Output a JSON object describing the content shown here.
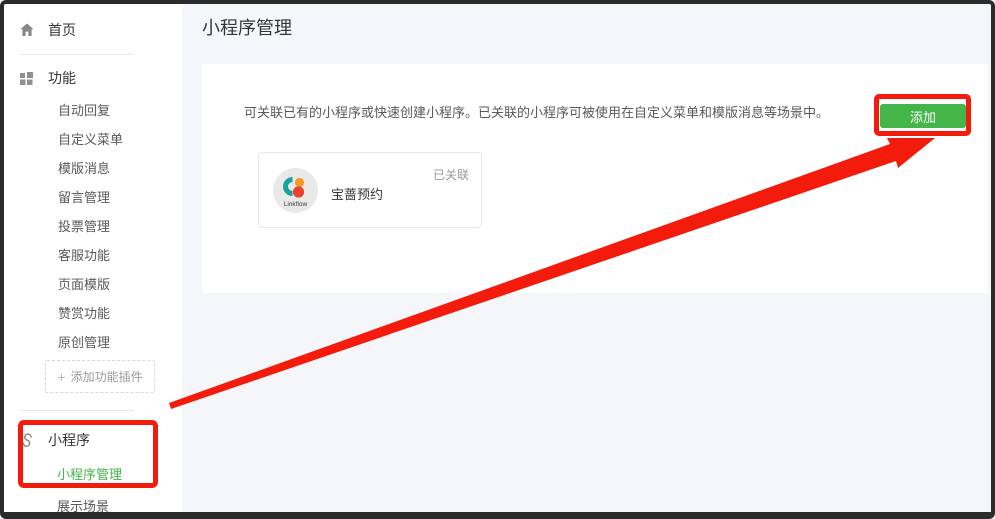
{
  "header": {
    "title": "小程序管理"
  },
  "sidebar": {
    "home": {
      "label": "首页"
    },
    "func": {
      "label": "功能",
      "items": [
        "自动回复",
        "自定义菜单",
        "模版消息",
        "留言管理",
        "投票管理",
        "客服功能",
        "页面模版",
        "赞赏功能",
        "原创管理"
      ]
    },
    "add_plugin": {
      "icon": "+",
      "label": "添加功能插件"
    },
    "miniprogram": {
      "label": "小程序",
      "items": [
        {
          "label": "小程序管理",
          "active": true
        },
        {
          "label": "展示场景",
          "active": false
        }
      ]
    }
  },
  "main": {
    "description": "可关联已有的小程序或快速创建小程序。已关联的小程序可被使用在自定义菜单和模版消息等场景中。",
    "add_button_label": "添加",
    "linked_program": {
      "name": "宝蔷预约",
      "status": "已关联",
      "logo_text": "Linkflow"
    }
  },
  "colors": {
    "accent_green": "#44b549",
    "annotation_red": "#f31b0c",
    "page_bg": "#f4f6f9",
    "frame": "#2b2b2b"
  }
}
